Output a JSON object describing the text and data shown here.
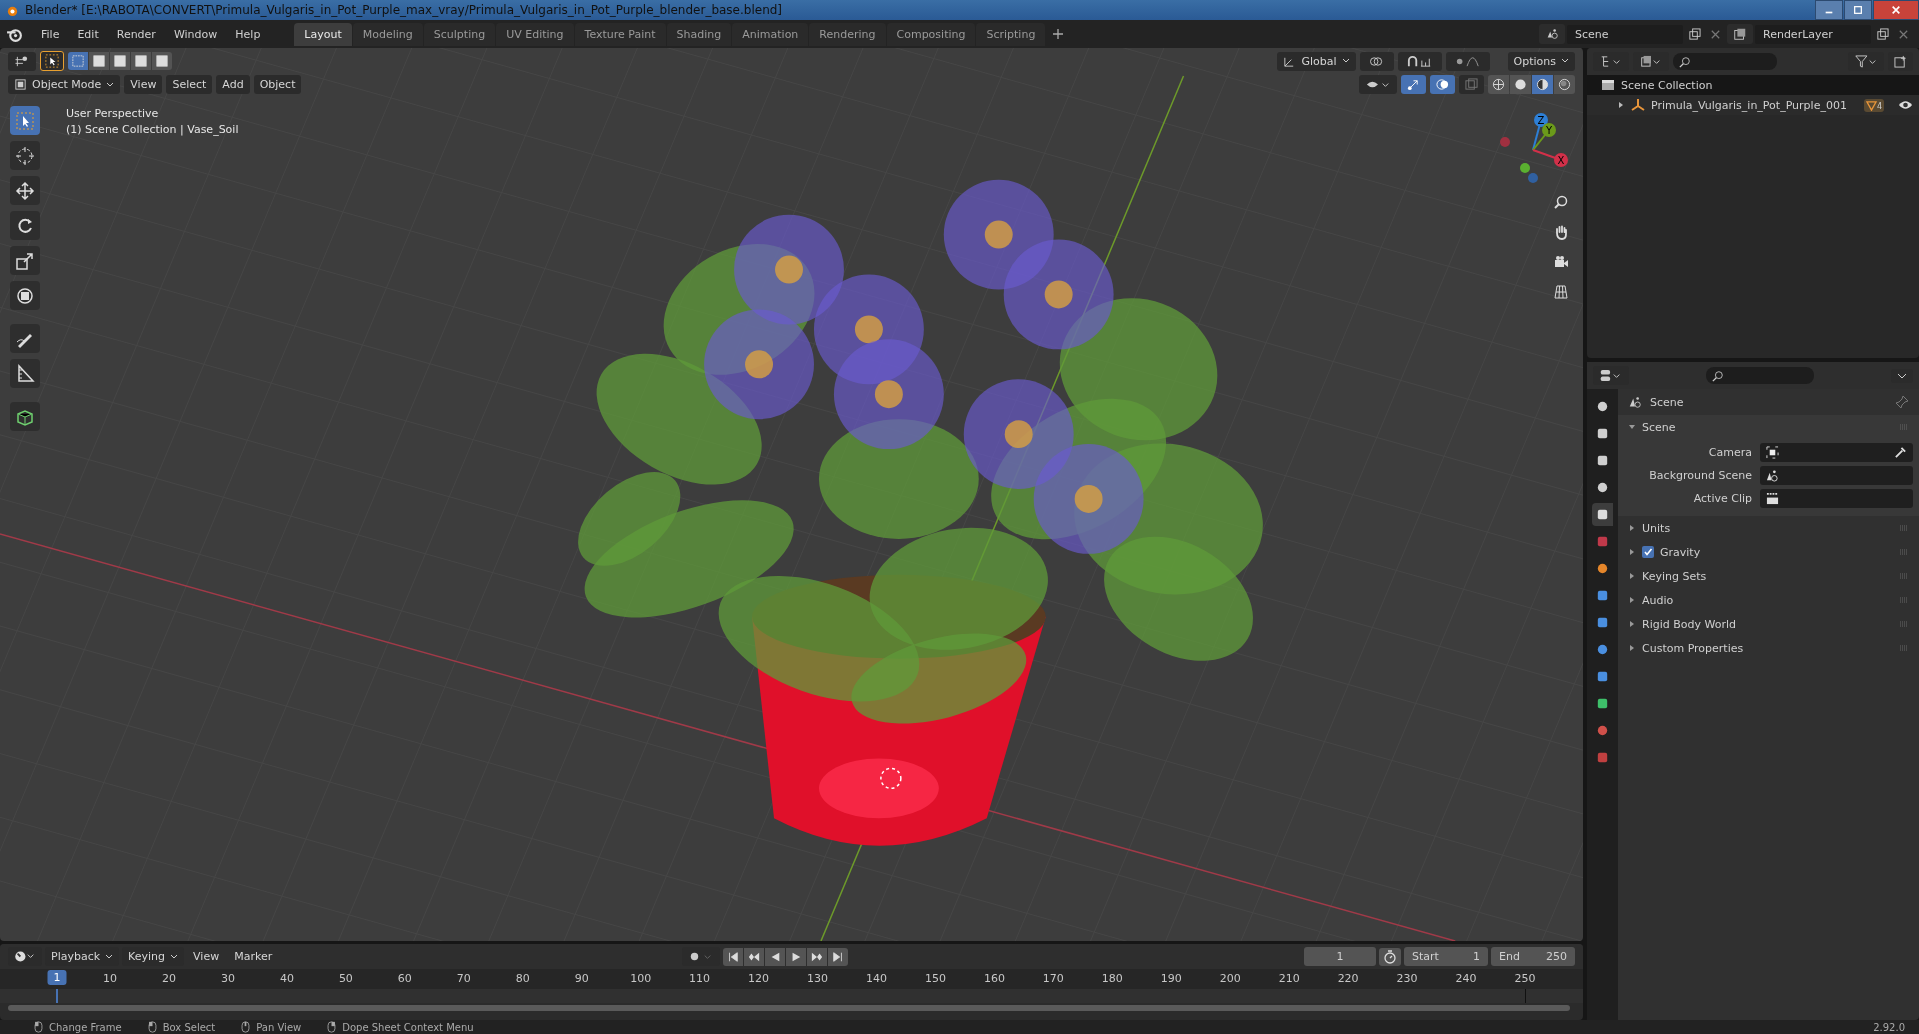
{
  "window": {
    "title": "Blender* [E:\\RABOTA\\CONVERT\\Primula_Vulgaris_in_Pot_Purple_max_vray/Primula_Vulgaris_in_Pot_Purple_blender_base.blend]"
  },
  "menu": [
    "File",
    "Edit",
    "Render",
    "Window",
    "Help"
  ],
  "workspaces": [
    {
      "label": "Layout",
      "selected": true
    },
    {
      "label": "Modeling",
      "selected": false
    },
    {
      "label": "Sculpting",
      "selected": false
    },
    {
      "label": "UV Editing",
      "selected": false
    },
    {
      "label": "Texture Paint",
      "selected": false
    },
    {
      "label": "Shading",
      "selected": false
    },
    {
      "label": "Animation",
      "selected": false
    },
    {
      "label": "Rendering",
      "selected": false
    },
    {
      "label": "Compositing",
      "selected": false
    },
    {
      "label": "Scripting",
      "selected": false
    }
  ],
  "scene": "Scene",
  "view_layer": "RenderLayer",
  "viewport": {
    "transform_orientation": "Global",
    "options": "Options",
    "mode": "Object Mode",
    "menus": [
      "View",
      "Select",
      "Add",
      "Object"
    ],
    "info": [
      "User Perspective",
      "(1) Scene Collection | Vase_Soil"
    ],
    "select_modes": [
      {
        "selected": true
      },
      {
        "selected": false
      },
      {
        "selected": false
      },
      {
        "selected": false
      },
      {
        "selected": false
      }
    ],
    "shading": [
      {
        "kind": "wireframe",
        "selected": false
      },
      {
        "kind": "solid",
        "selected": false
      },
      {
        "kind": "material",
        "selected": true
      },
      {
        "kind": "rendered",
        "selected": false
      }
    ],
    "tools": [
      {
        "kind": "select",
        "selected": true
      },
      {
        "kind": "cursor",
        "selected": false
      },
      {
        "kind": "move",
        "selected": false
      },
      {
        "kind": "rotate",
        "selected": false
      },
      {
        "kind": "scale",
        "selected": false
      },
      {
        "kind": "transform",
        "selected": false
      },
      {
        "kind": "annotate",
        "selected": false
      },
      {
        "kind": "measure",
        "selected": false
      },
      {
        "kind": "add_cube",
        "selected": false
      }
    ],
    "gizmo_axes": [
      "Z",
      "Y",
      "X"
    ]
  },
  "outliner": {
    "root": "Scene Collection",
    "items": [
      {
        "name": "Primula_Vulgaris_in_Pot_Purple_001",
        "expanded": false,
        "badge": "4"
      }
    ]
  },
  "properties": {
    "tabs": [
      {
        "kind": "tool",
        "selected": false
      },
      {
        "kind": "render",
        "selected": false
      },
      {
        "kind": "output",
        "selected": false
      },
      {
        "kind": "view_layer",
        "selected": false
      },
      {
        "kind": "scene",
        "selected": true
      },
      {
        "kind": "world",
        "selected": false
      },
      {
        "kind": "object",
        "selected": false
      },
      {
        "kind": "modifiers",
        "selected": false
      },
      {
        "kind": "particles",
        "selected": false
      },
      {
        "kind": "physics",
        "selected": false
      },
      {
        "kind": "constraints",
        "selected": false
      },
      {
        "kind": "data",
        "selected": false
      },
      {
        "kind": "material",
        "selected": false
      },
      {
        "kind": "texture",
        "selected": false
      }
    ],
    "context": "Scene",
    "panel": {
      "title": "Scene",
      "expanded": true,
      "fields": [
        {
          "label": "Camera",
          "kind": "camera"
        },
        {
          "label": "Background Scene",
          "kind": "scene"
        },
        {
          "label": "Active Clip",
          "kind": "clip"
        }
      ]
    },
    "sections": [
      {
        "label": "Units",
        "kind": "plain",
        "expanded": false
      },
      {
        "label": "Gravity",
        "kind": "checkbox",
        "checked": true,
        "expanded": false
      },
      {
        "label": "Keying Sets",
        "kind": "plain",
        "expanded": false
      },
      {
        "label": "Audio",
        "kind": "plain",
        "expanded": false
      },
      {
        "label": "Rigid Body World",
        "kind": "plain",
        "expanded": false
      },
      {
        "label": "Custom Properties",
        "kind": "plain",
        "expanded": false
      }
    ]
  },
  "timeline": {
    "menus": [
      {
        "label": "Playback",
        "dropdown": true
      },
      {
        "label": "Keying",
        "dropdown": true
      },
      {
        "label": "View",
        "dropdown": false
      },
      {
        "label": "Marker",
        "dropdown": false
      }
    ],
    "current_frame": "1",
    "start_label": "Start",
    "start": "1",
    "end_label": "End",
    "end": "250",
    "playhead": "1",
    "ticks": [
      "10",
      "20",
      "30",
      "40",
      "50",
      "60",
      "70",
      "80",
      "90",
      "100",
      "110",
      "120",
      "130",
      "140",
      "150",
      "160",
      "170",
      "180",
      "190",
      "200",
      "210",
      "220",
      "230",
      "240",
      "250"
    ]
  },
  "status_bar": {
    "hints": [
      "Change Frame",
      "Box Select",
      "Pan View",
      "Dope Sheet Context Menu"
    ],
    "version": "2.92.0"
  }
}
